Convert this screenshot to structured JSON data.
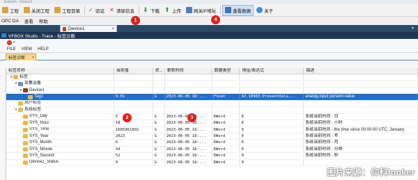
{
  "top_strip": "Eclench · Device1",
  "toolbar": {
    "items": [
      {
        "label": "工程",
        "icon": "project-icon"
      },
      {
        "label": "关闭工程",
        "icon": "close-project-icon"
      },
      {
        "label": "工程目录",
        "icon": "project-folder-icon"
      },
      {
        "label": "验证",
        "icon": "check-icon"
      },
      {
        "label": "清除信息",
        "icon": "clear-icon"
      },
      {
        "label": "下载",
        "icon": "download-icon"
      },
      {
        "label": "上传",
        "icon": "upload-icon"
      },
      {
        "label": "网关IP地址",
        "icon": "network-icon"
      },
      {
        "label": "查看数据",
        "icon": "view-data-icon"
      },
      {
        "label": "关于",
        "icon": "help-icon"
      }
    ]
  },
  "menubar": [
    "OPC DA",
    "查看",
    "帮助"
  ],
  "doc_tab": {
    "label": "Device1",
    "close": "×",
    "overflow": "▾"
  },
  "window_title": "VFBOX Studio - Trace - 标签诊断",
  "app_menu": [
    "FILE",
    "VIEW",
    "HELP"
  ],
  "panel_tab": {
    "label": "标签诊断",
    "close": "×"
  },
  "columns": [
    "标签名称",
    "当前值",
    "状...",
    "更新时间",
    "数据类型",
    "地址/表达式",
    "描述"
  ],
  "rows": [
    {
      "indent": 0,
      "exp": "▾",
      "icon_color": "#e7b84b",
      "name": "标签",
      "value": "",
      "status": "",
      "time": "",
      "type": "",
      "addr": "",
      "desc": ""
    },
    {
      "indent": 1,
      "exp": "▾",
      "icon_color": "#6b8fb8",
      "name": "采集设备",
      "value": "",
      "status": "",
      "time": "",
      "type": "",
      "addr": "",
      "desc": ""
    },
    {
      "indent": 2,
      "exp": "▾",
      "icon_color": "#8b3a2a",
      "name": "Device1",
      "value": "",
      "status": "",
      "time": "",
      "type": "",
      "addr": "",
      "desc": ""
    },
    {
      "indent": 3,
      "exp": "",
      "icon_color": "#e7b84b",
      "name": "Tag1",
      "value": "9.01",
      "status": "G",
      "time": "2023-06-05 18:...",
      "type": "Float",
      "addr": "AI.10983.PresentValu...",
      "desc": "analog-input persent value",
      "selected": true
    },
    {
      "indent": 1,
      "exp": "",
      "icon_color": "#e7b84b",
      "name": "用户标签",
      "value": "",
      "status": "",
      "time": "",
      "type": "",
      "addr": "",
      "desc": ""
    },
    {
      "indent": 1,
      "exp": "▾",
      "icon_color": "#e7b84b",
      "name": "系统标签",
      "value": "",
      "status": "",
      "time": "",
      "type": "",
      "addr": "",
      "desc": ""
    },
    {
      "indent": 2,
      "exp": "",
      "icon_color": "#e7b84b",
      "name": "SYS_Day",
      "value": "5",
      "status": "G",
      "time": "2023-06-05 18:...",
      "type": "DWord",
      "addr": "0",
      "desc": "系统当前时间 - 日"
    },
    {
      "indent": 2,
      "exp": "",
      "icon_color": "#e7b84b",
      "name": "SYS_Hour",
      "value": "18",
      "status": "G",
      "time": "2023-06-05 18:...",
      "type": "DWord",
      "addr": "0",
      "desc": "系统当前时间 - 小时"
    },
    {
      "indent": 2,
      "exp": "",
      "icon_color": "#e7b84b",
      "name": "SYS_Time",
      "value": "1685961892",
      "status": "G",
      "time": "2023-06-05 18:...",
      "type": "DWord",
      "addr": "0",
      "desc": "系统当前时间 - the time since 00:00:00 UTC, January"
    },
    {
      "indent": 2,
      "exp": "",
      "icon_color": "#e7b84b",
      "name": "SYS_Year",
      "value": "2023",
      "status": "G",
      "time": "2023-06-05 18:...",
      "type": "DWord",
      "addr": "0",
      "desc": "系统当前时间 - 年"
    },
    {
      "indent": 2,
      "exp": "",
      "icon_color": "#e7b84b",
      "name": "SYS_Month",
      "value": "6",
      "status": "G",
      "time": "2023-06-05 18:...",
      "type": "DWord",
      "addr": "0",
      "desc": "系统当前时间 - 月"
    },
    {
      "indent": 2,
      "exp": "",
      "icon_color": "#e7b84b",
      "name": "SYS_Minute",
      "value": "44",
      "status": "G",
      "time": "2023-06-05 18:...",
      "type": "DWord",
      "addr": "0",
      "desc": "系统当前时间 - 分钟"
    },
    {
      "indent": 2,
      "exp": "",
      "icon_color": "#e7b84b",
      "name": "SYS_Second",
      "value": "52",
      "status": "G",
      "time": "2023-06-05 18:...",
      "type": "DWord",
      "addr": "0",
      "desc": "系统当前时间 - 秒"
    },
    {
      "indent": 2,
      "exp": "",
      "icon_color": "#e7b84b",
      "name": "Device1_Status",
      "value": "0",
      "status": "G",
      "time": "2023-06-05 18:...",
      "type": "DWord",
      "addr": "0",
      "desc": ""
    }
  ],
  "badges": [
    "1",
    "2",
    "3",
    "4"
  ],
  "watermark": "图片来源：仰科lonker",
  "colors": {
    "accent_blue": "#1f70c9",
    "badge_red": "#e0211c",
    "title_bar": "#1e3553"
  }
}
